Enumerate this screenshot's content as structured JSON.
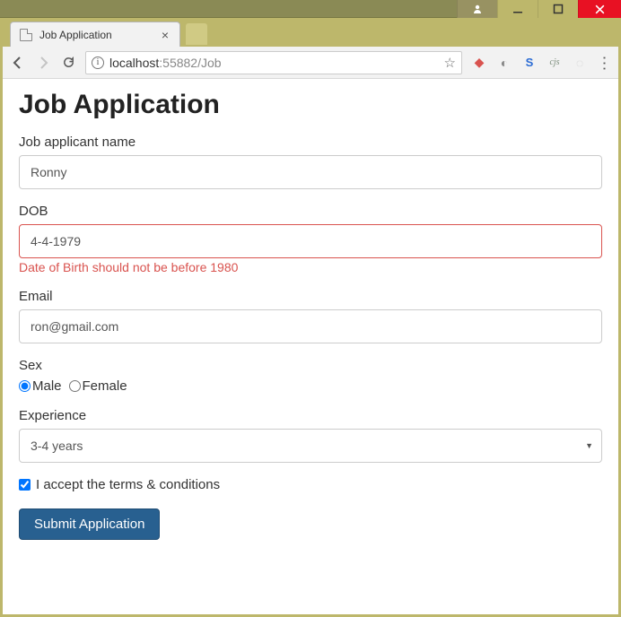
{
  "window": {
    "tab_title": "Job Application",
    "url_host": "localhost",
    "url_port": ":55882",
    "url_path": "/Job"
  },
  "page": {
    "heading": "Job Application",
    "fields": {
      "name": {
        "label": "Job applicant name",
        "value": "Ronny"
      },
      "dob": {
        "label": "DOB",
        "value": "4-4-1979",
        "error": "Date of Birth should not be before 1980"
      },
      "email": {
        "label": "Email",
        "value": "ron@gmail.com"
      },
      "sex": {
        "label": "Sex",
        "options": [
          "Male",
          "Female"
        ],
        "selected": "Male"
      },
      "experience": {
        "label": "Experience",
        "selected": "3-4 years"
      },
      "terms": {
        "label": "I accept the terms & conditions",
        "checked": true
      }
    },
    "submit_label": "Submit Application"
  }
}
